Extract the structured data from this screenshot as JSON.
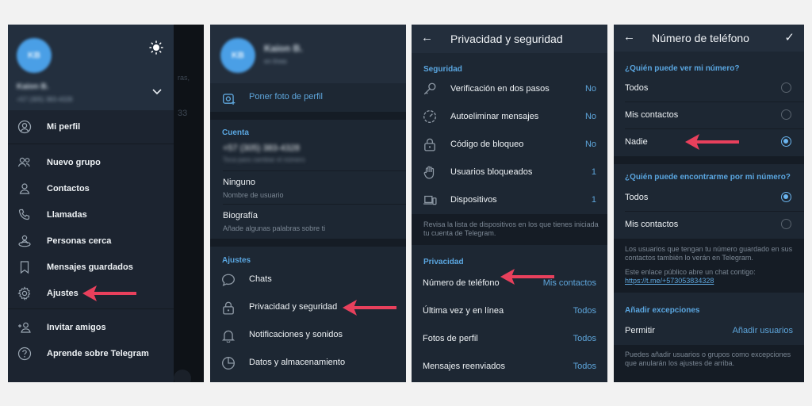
{
  "panel1": {
    "profile_initials": "KB",
    "profile_name_blurred": "Kaion B.",
    "profile_phone_blurred": "+57 (305) 383-4328",
    "background_chat_snippets": [
      "ras,",
      "33"
    ],
    "menu_items": [
      {
        "icon": "user-circle-icon",
        "label": "Mi perfil"
      },
      {
        "icon": "group-icon",
        "label": "Nuevo grupo"
      },
      {
        "icon": "contact-icon",
        "label": "Contactos"
      },
      {
        "icon": "phone-icon",
        "label": "Llamadas"
      },
      {
        "icon": "people-nearby-icon",
        "label": "Personas cerca"
      },
      {
        "icon": "bookmark-icon",
        "label": "Mensajes guardados"
      },
      {
        "icon": "gear-icon",
        "label": "Ajustes"
      },
      {
        "icon": "add-user-icon",
        "label": "Invitar amigos"
      },
      {
        "icon": "help-icon",
        "label": "Aprende sobre Telegram"
      }
    ],
    "highlighted_item": "Ajustes"
  },
  "panel2": {
    "profile_initials": "KB",
    "profile_name_blurred": "Kaion B.",
    "profile_status_blurred": "en línea",
    "set_photo_label": "Poner foto de perfil",
    "account_section": "Cuenta",
    "phone_blurred": "+57 (305) 383-4328",
    "phone_hint_blurred": "Toca para cambiar el número",
    "username_value": "Ninguno",
    "username_label": "Nombre de usuario",
    "bio_value": "Biografía",
    "bio_label": "Añade algunas palabras sobre ti",
    "settings_section": "Ajustes",
    "settings_items": [
      {
        "icon": "chat-bubble-icon",
        "label": "Chats"
      },
      {
        "icon": "lock-icon",
        "label": "Privacidad y seguridad"
      },
      {
        "icon": "bell-icon",
        "label": "Notificaciones y sonidos"
      },
      {
        "icon": "pie-chart-icon",
        "label": "Datos y almacenamiento"
      }
    ],
    "highlighted_item": "Privacidad y seguridad"
  },
  "panel3": {
    "title": "Privacidad y seguridad",
    "security_section": "Seguridad",
    "security_items": [
      {
        "icon": "key-icon",
        "label": "Verificación en dos pasos",
        "value": "No"
      },
      {
        "icon": "timer-icon",
        "label": "Autoeliminar mensajes",
        "value": "No"
      },
      {
        "icon": "lock-icon",
        "label": "Código de bloqueo",
        "value": "No"
      },
      {
        "icon": "hand-icon",
        "label": "Usuarios bloqueados",
        "value": "1"
      },
      {
        "icon": "devices-icon",
        "label": "Dispositivos",
        "value": "1"
      }
    ],
    "devices_hint": "Revisa la lista de dispositivos en los que tienes iniciada tu cuenta de Telegram.",
    "privacy_section": "Privacidad",
    "privacy_items": [
      {
        "label": "Número de teléfono",
        "value": "Mis contactos"
      },
      {
        "label": "Última vez y en línea",
        "value": "Todos"
      },
      {
        "label": "Fotos de perfil",
        "value": "Todos"
      },
      {
        "label": "Mensajes reenviados",
        "value": "Todos"
      }
    ],
    "highlighted_item": "Número de teléfono"
  },
  "panel4": {
    "title": "Número de teléfono",
    "who_can_see_section": "¿Quién puede ver mi número?",
    "who_can_see_options": [
      {
        "label": "Todos",
        "selected": false
      },
      {
        "label": "Mis contactos",
        "selected": false
      },
      {
        "label": "Nadie",
        "selected": true
      }
    ],
    "who_can_find_section": "¿Quién puede encontrarme por mi número?",
    "who_can_find_options": [
      {
        "label": "Todos",
        "selected": true
      },
      {
        "label": "Mis contactos",
        "selected": false
      }
    ],
    "find_hint": "Los usuarios que tengan tu número guardado en sus contactos también lo verán en Telegram.",
    "link_hint": "Este enlace público abre un chat contigo:",
    "public_link": "https://t.me/+573053834328",
    "exceptions_section": "Añadir excepciones",
    "allow_label": "Permitir",
    "add_users_label": "Añadir usuarios",
    "exceptions_hint": "Puedes añadir usuarios o grupos como excepciones que anularán los ajustes de arriba.",
    "highlighted_item": "Nadie"
  },
  "colors": {
    "accent": "#5ea6dc",
    "panel_bg": "#1d2733",
    "header_bg": "#232e3c",
    "arrow": "#e8405c",
    "avatar": "#4a9fe6"
  }
}
